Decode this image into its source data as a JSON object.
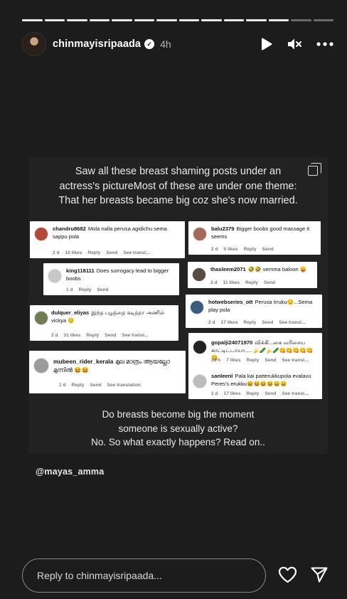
{
  "story": {
    "progress_segments": 14,
    "seen_segments": 12,
    "username": "chinmayisripaada",
    "time": "4h",
    "verified_mark": "✓"
  },
  "card": {
    "top_text": [
      "Saw all these breast shaming posts under an",
      "actress's pictureMost of these are under one theme:",
      "That her breasts became big coz she's now married."
    ],
    "bottom_text": [
      "Do breasts become big the moment",
      "someone is sexually active?",
      "No. So what exactly happens? Read on.."
    ]
  },
  "comments": {
    "c1": {
      "user": "chandru8682",
      "text": "Mola nalla perusa agidichu sema sappu pola",
      "meta": [
        "2 d",
        "10 likes",
        "Reply",
        "Send",
        "See transl..."
      ]
    },
    "c2": {
      "user": "king118111",
      "text": "Does surrogacy lead to bigger boobs",
      "meta": [
        "1 d",
        "Reply",
        "Send"
      ]
    },
    "c3": {
      "user": "dulquer_eliyas",
      "text": "இந்த பழத்தை கடித்தா அணில் vickya 😌",
      "meta": [
        "2 d",
        "31 likes",
        "Reply",
        "Send",
        "See transl..."
      ]
    },
    "c4": {
      "user": "mubeen_rider_kerala",
      "text": "മുല മാത്രം ആയല്ലോ മുന്നിൽ 😆😆",
      "meta": [
        "1 d",
        "Reply",
        "Send",
        "See translation"
      ]
    },
    "c5": {
      "user": "balu2379",
      "text": "Bigger boobs good massage it seems",
      "meta": [
        "2 d",
        "5 likes",
        "Reply",
        "Send"
      ]
    },
    "c6": {
      "user": "thasleem2071",
      "text": "🤣🤣 semma baloon 😛",
      "meta": [
        "2 d",
        "11 likes",
        "Reply",
        "Send"
      ]
    },
    "c7": {
      "user": "hotwebseries_ott",
      "text": "Perusa irruku😏...Sema play pola",
      "meta": [
        "2 d",
        "17 likes",
        "Reply",
        "Send",
        "See transl..."
      ]
    },
    "c8": {
      "user": "gopalji24071970",
      "text": "விக்கி...கை வரிசைய காட்டிட்டாயா.....🍌🥒🍌🥒😋😋😋😋😋😋",
      "meta": [
        "18 h",
        "7 likes",
        "Reply",
        "Send",
        "See transl..."
      ]
    },
    "c9": {
      "user": "sanleenl",
      "text": "Pala kai patterukkupola evalavu Peres's erukku😆😆😆😆😄😄",
      "meta": [
        "2 d",
        "17 likes",
        "Reply",
        "Send",
        "See transl..."
      ]
    }
  },
  "mention": "@mayas_amma",
  "reply": {
    "placeholder": "Reply to chinmayisripaada..."
  },
  "colors": {
    "background": "#1c1c1c",
    "card": "#222222",
    "comment_bg": "#ffffff"
  },
  "icons": [
    "play-icon",
    "mute-icon",
    "more-icon",
    "copy-icon",
    "heart-icon",
    "send-icon"
  ]
}
